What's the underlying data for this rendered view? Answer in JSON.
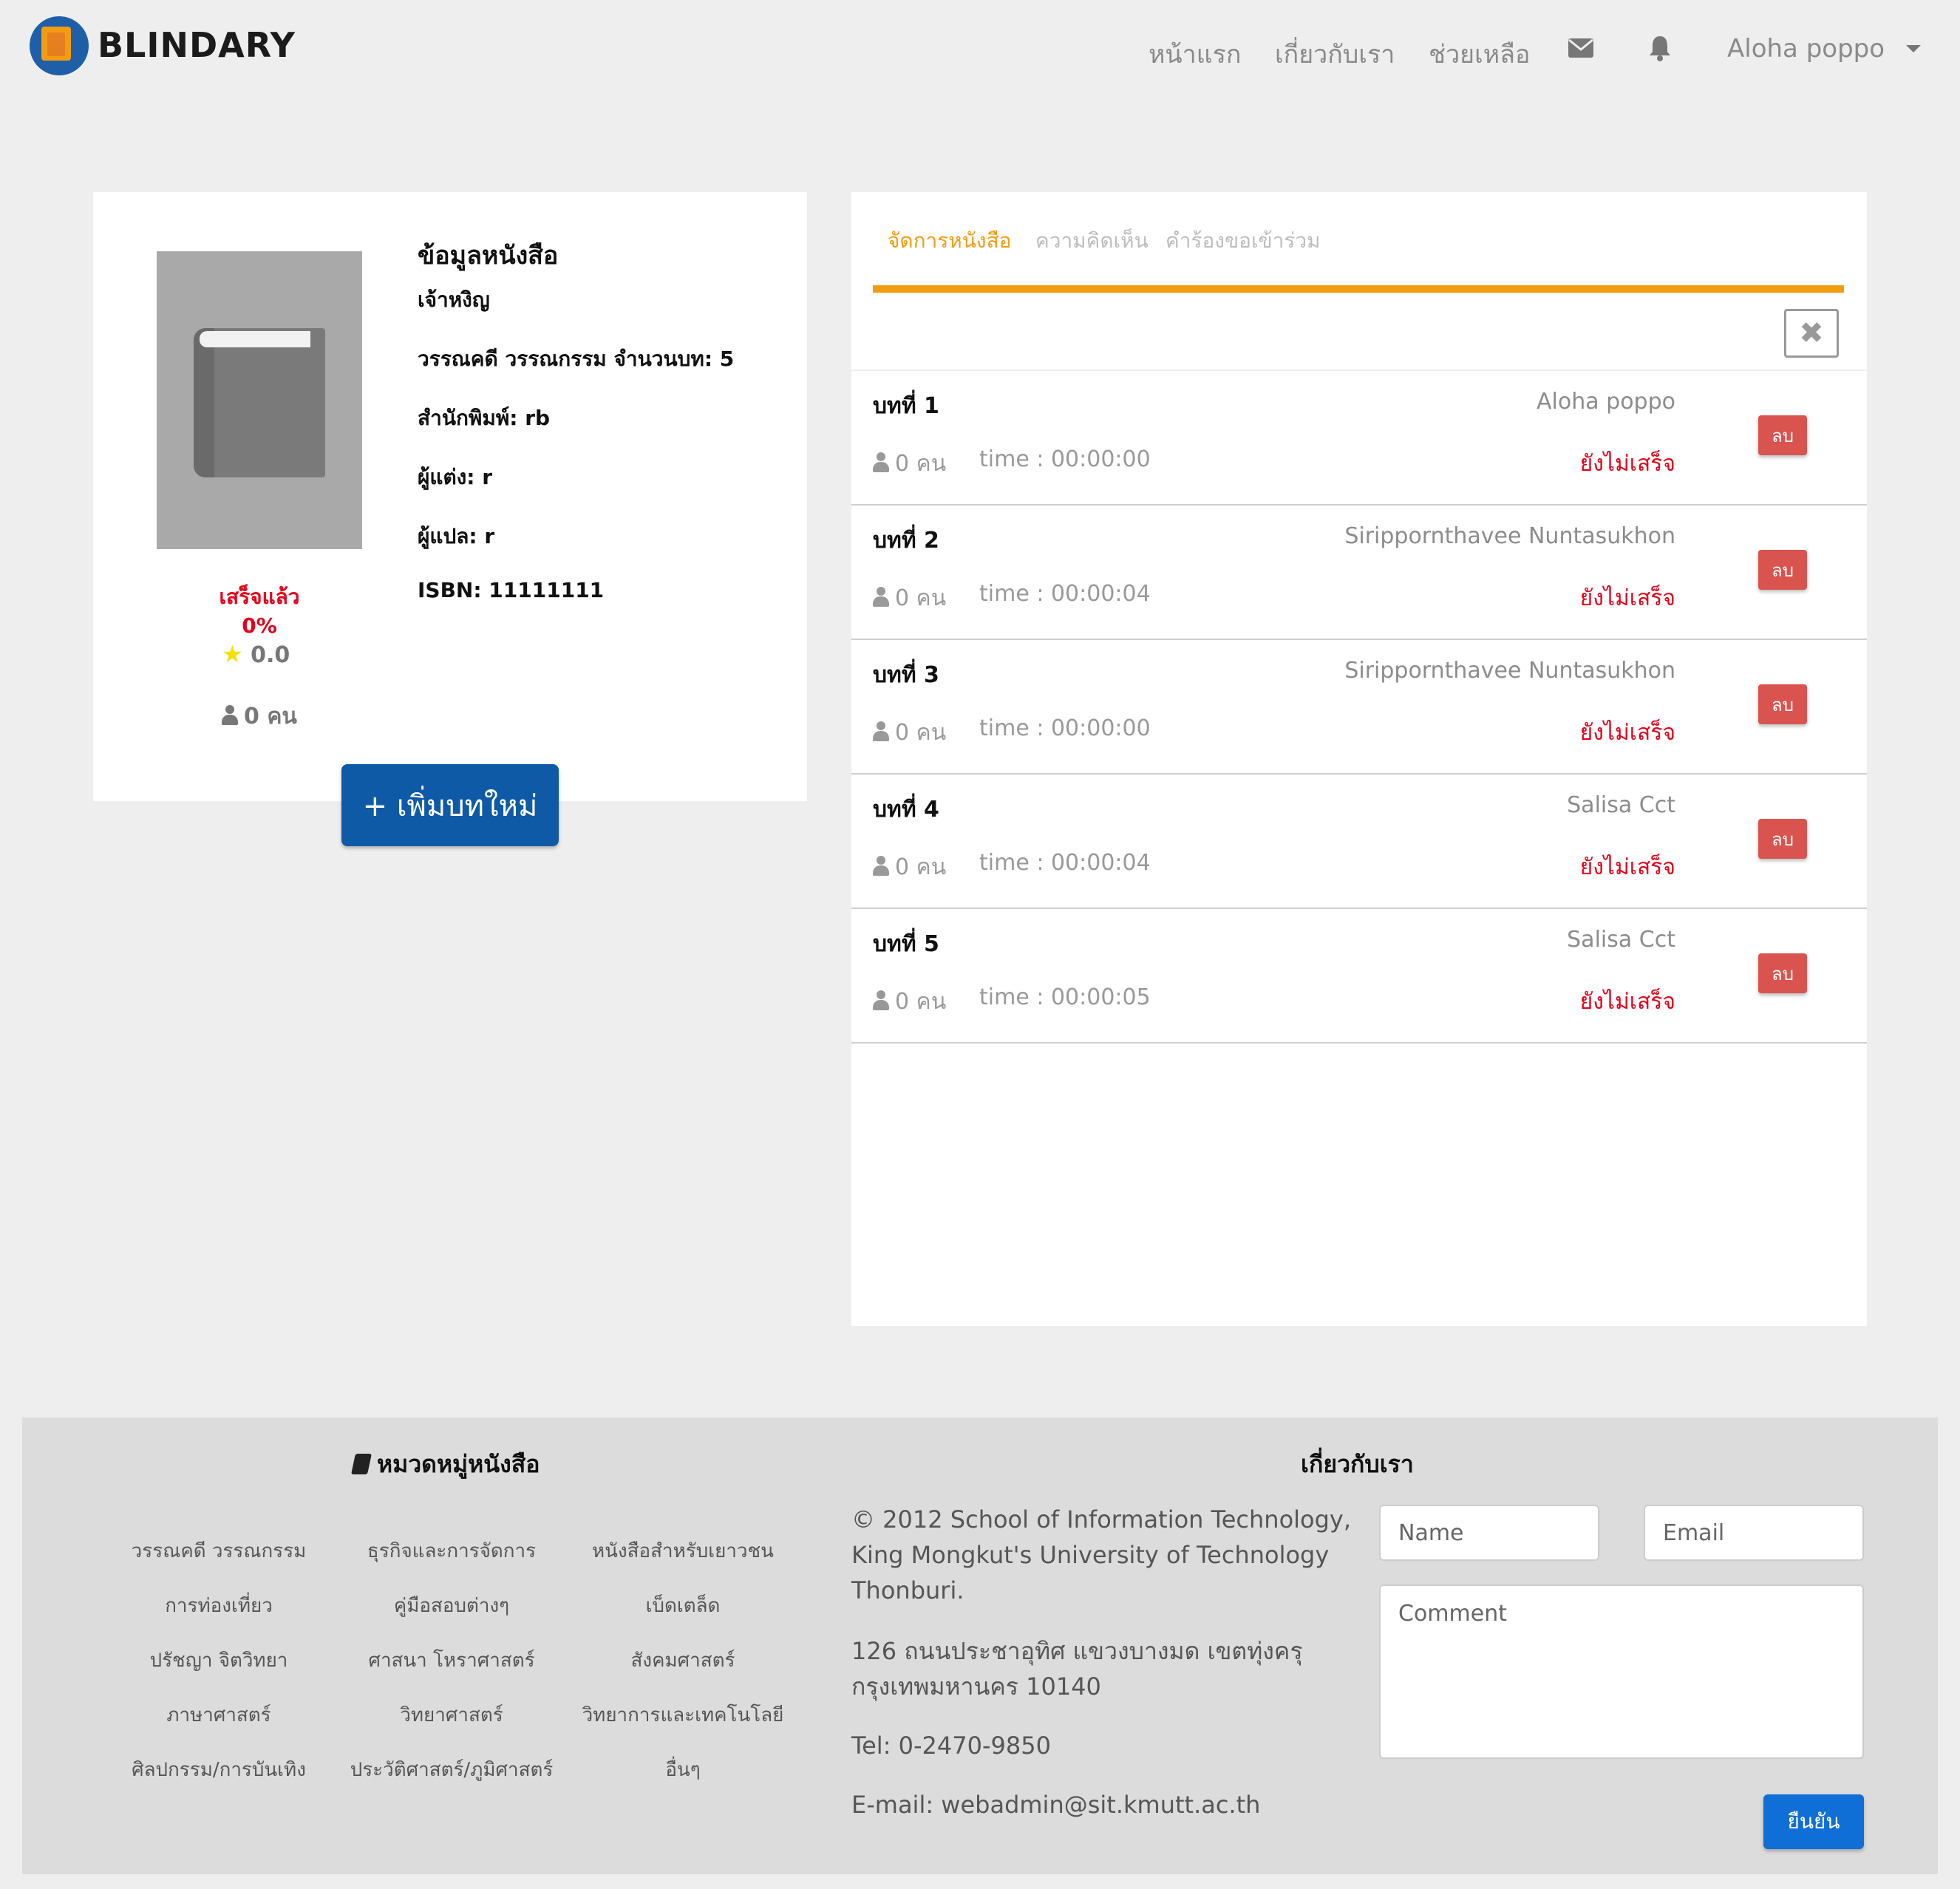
{
  "brand": {
    "name": "BLINDARY"
  },
  "nav": {
    "home": "หน้าแรก",
    "about": "เกี่ยวกับเรา",
    "help": "ช่วยเหลือ",
    "user": "Aloha poppo"
  },
  "book": {
    "title": "ข้อมูลหนังสือ",
    "name": "เจ้าหงิญ",
    "category_line": "วรรณคดี วรรณกรรม จำนวนบท: 5",
    "publisher": "สำนักพิมพ์: rb",
    "author": "ผู้แต่ง: r",
    "translator": "ผู้แปล: r",
    "isbn": "ISBN: 11111111",
    "progress": "เสร็จแล้ว 0%",
    "rating": "0.0",
    "readers": "0 คน"
  },
  "add_chapter_button": "+ เพิ่มบทใหม่",
  "tabs": [
    "จัดการหนังสือ",
    "ความคิดเห็น",
    "คำร้องขอเข้าร่วม"
  ],
  "chapters": [
    {
      "title": "บทที่ 1",
      "owner": "Aloha poppo",
      "readers": "0 คน",
      "time": "time : 00:00:00",
      "status": "ยังไม่เสร็จ",
      "delete": "ลบ"
    },
    {
      "title": "บทที่ 2",
      "owner": "Sirippornthavee Nuntasukhon",
      "readers": "0 คน",
      "time": "time : 00:00:04",
      "status": "ยังไม่เสร็จ",
      "delete": "ลบ"
    },
    {
      "title": "บทที่ 3",
      "owner": "Sirippornthavee Nuntasukhon",
      "readers": "0 คน",
      "time": "time : 00:00:00",
      "status": "ยังไม่เสร็จ",
      "delete": "ลบ"
    },
    {
      "title": "บทที่ 4",
      "owner": "Salisa Cct",
      "readers": "0 คน",
      "time": "time : 00:00:04",
      "status": "ยังไม่เสร็จ",
      "delete": "ลบ"
    },
    {
      "title": "บทที่ 5",
      "owner": "Salisa Cct",
      "readers": "0 คน",
      "time": "time : 00:00:05",
      "status": "ยังไม่เสร็จ",
      "delete": "ลบ"
    }
  ],
  "footer": {
    "categories_title": "หมวดหมู่หนังสือ",
    "categories": [
      "วรรณคดี วรรณกรรม",
      "ธุรกิจและการจัดการ",
      "หนังสือสำหรับเยาวชน",
      "การท่องเที่ยว",
      "คู่มือสอบต่างๆ",
      "เบ็ดเตล็ด",
      "ปรัชญา จิตวิทยา",
      "ศาสนา โหราศาสตร์",
      "สังคมศาสตร์",
      "ภาษาศาสตร์",
      "วิทยาศาสตร์",
      "วิทยาการและเทคโนโลยี",
      "ศิลปกรรม/การบันเทิง",
      "ประวัติศาสตร์/ภูมิศาสตร์",
      "อื่นๆ"
    ],
    "about_title": "เกี่ยวกับเรา",
    "copyright_1": "© 2012 School of Information Technology,",
    "copyright_2": "King Mongkut's University of Technology",
    "copyright_3": "Thonburi.",
    "address_1": "126 ถนนประชาอุทิศ แขวงบางมด เขตทุ่งครุ",
    "address_2": "กรุงเทพมหานคร 10140",
    "tel": "Tel: 0-2470-9850",
    "email": "E-mail: webadmin@sit.kmutt.ac.th",
    "name_placeholder": "Name",
    "email_placeholder": "Email",
    "comment_placeholder": "Comment",
    "submit": "ยืนยัน"
  },
  "colors": {
    "accent": "#f39c12",
    "primary": "#0f5aa6",
    "danger": "#d9534f",
    "status_red": "#e4001a"
  }
}
